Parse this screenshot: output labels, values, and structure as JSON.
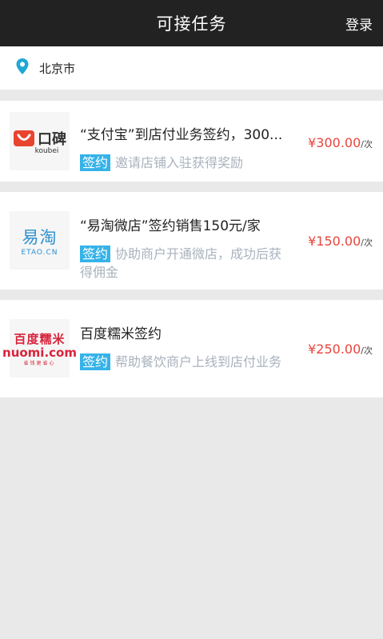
{
  "header": {
    "title": "可接任务",
    "login_label": "登录"
  },
  "location": {
    "icon": "location-pin-icon",
    "city": "北京市"
  },
  "tasks": [
    {
      "logo": {
        "text": "口碑",
        "sub": "koubei"
      },
      "title": "“支付宝”到店付业务签约，300...",
      "tag": "签约",
      "description": "邀请店铺入驻获得奖励",
      "price": "¥300.00",
      "unit": "/次"
    },
    {
      "logo": {
        "text": "易淘",
        "sub": "ETAO.CN"
      },
      "title": "“易淘微店”签约销售150元/家",
      "tag": "签约",
      "description": "协助商户开通微店，成功后获得佣金",
      "price": "¥150.00",
      "unit": "/次"
    },
    {
      "logo": {
        "text": "百度糯米",
        "sub": "nuomi.com",
        "tagline": "省钱更省心"
      },
      "title": "百度糯米签约",
      "tag": "签约",
      "description": "帮助餐饮商户上线到店付业务",
      "price": "¥250.00",
      "unit": "/次"
    }
  ],
  "colors": {
    "header_bg": "#222222",
    "tag_bg": "#36b2e8",
    "price": "#e8453c",
    "location_pin": "#1fa8d4",
    "desc_text": "#a9b2bd"
  }
}
